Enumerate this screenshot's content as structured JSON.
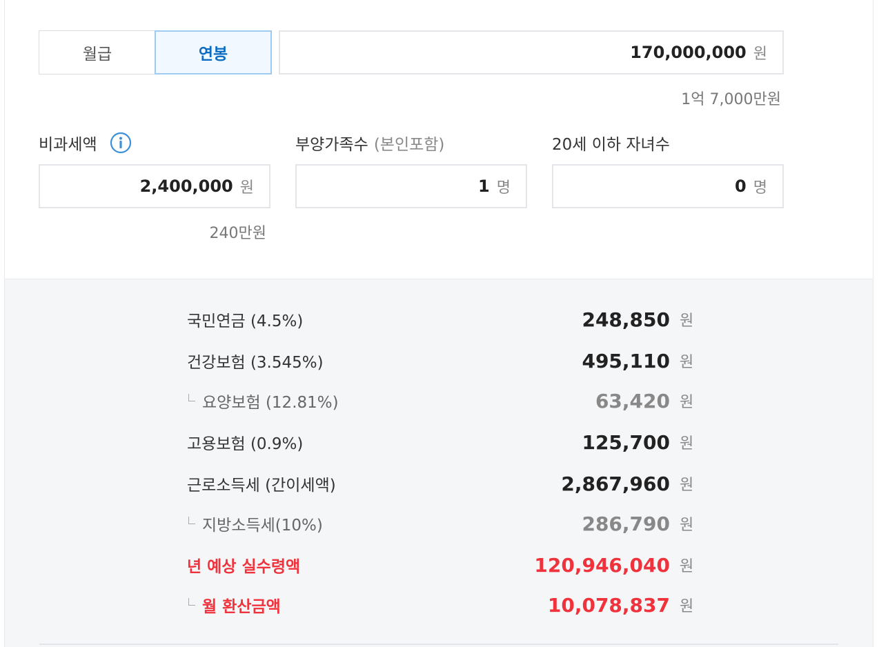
{
  "tabs": {
    "monthly_label": "월급",
    "annual_label": "연봉",
    "selected": "annual"
  },
  "salary": {
    "value": "170,000,000",
    "unit": "원",
    "hint": "1억 7,000만원"
  },
  "nontaxable": {
    "label": "비과세액",
    "info_icon": "info-icon",
    "value": "2,400,000",
    "unit": "원",
    "hint": "240만원"
  },
  "dependents": {
    "label": "부양가족수",
    "sublabel": "(본인포함)",
    "value": "1",
    "unit": "명"
  },
  "children": {
    "label": "20세 이하 자녀수",
    "value": "0",
    "unit": "명"
  },
  "results": [
    {
      "label": "국민연금 (4.5%)",
      "value": "248,850",
      "unit": "원"
    },
    {
      "label": "건강보험 (3.545%)",
      "value": "495,110",
      "unit": "원"
    },
    {
      "label": "요양보험 (12.81%)",
      "value": "63,420",
      "unit": "원"
    },
    {
      "label": "고용보험 (0.9%)",
      "value": "125,700",
      "unit": "원"
    },
    {
      "label": "근로소득세 (간이세액)",
      "value": "2,867,960",
      "unit": "원"
    },
    {
      "label": "지방소득세(10%)",
      "value": "286,790",
      "unit": "원"
    },
    {
      "label": "년 예상 실수령액",
      "value": "120,946,040",
      "unit": "원"
    },
    {
      "label": "월 환산금액",
      "value": "10,078,837",
      "unit": "원"
    }
  ],
  "colors": {
    "accent_blue": "#0b6cc2",
    "highlight_red": "#f0323c",
    "results_bg": "#f5f6f8"
  }
}
